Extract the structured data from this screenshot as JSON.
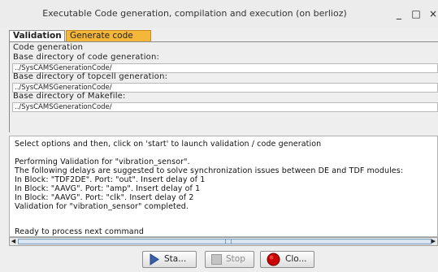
{
  "window": {
    "title": "Executable Code generation, compilation and execution (on berlioz)",
    "minimize_glyph": "_",
    "maximize_glyph": "□",
    "close_glyph": "×"
  },
  "tabs": [
    {
      "label": "Validation",
      "selected": true
    },
    {
      "label": "Generate code",
      "selected": false
    }
  ],
  "form": {
    "section_label": "Code generation",
    "codegen_dir_label": "Base directory of code generation:",
    "codegen_dir_value": "../SysCAMSGenerationCode/",
    "topcell_dir_label": "Base directory of topcell generation:",
    "topcell_dir_value": "../SysCAMSGenerationCode/",
    "makefile_dir_label": "Base directory of Makefile:",
    "makefile_dir_value": "../SysCAMSGenerationCode/"
  },
  "output": {
    "lines": [
      "Select options and then, click on 'start' to launch validation / code generation",
      "",
      "Performing Validation for \"vibration_sensor\".",
      "The following delays are suggested to solve synchronization issues between DE and TDF modules:",
      "In Block: \"TDF2DE\". Port: \"out\". Insert delay of 1",
      "In Block: \"AAVG\". Port: \"amp\". Insert delay of 1",
      "In Block: \"AAVG\". Port: \"clk\". Insert delay of 2",
      "Validation for \"vibration_sensor\" completed.",
      "",
      "",
      "Ready to process next command"
    ]
  },
  "buttons": {
    "start_label": "Sta...",
    "stop_label": "Stop",
    "close_label": "Clo..."
  },
  "icons": {
    "start": "play-icon",
    "stop": "stop-icon",
    "close": "close-circle-icon"
  },
  "colors": {
    "generate_tab": "#f5b73a",
    "close_icon": "#cc0000",
    "start_icon": "#3a5fa8"
  }
}
